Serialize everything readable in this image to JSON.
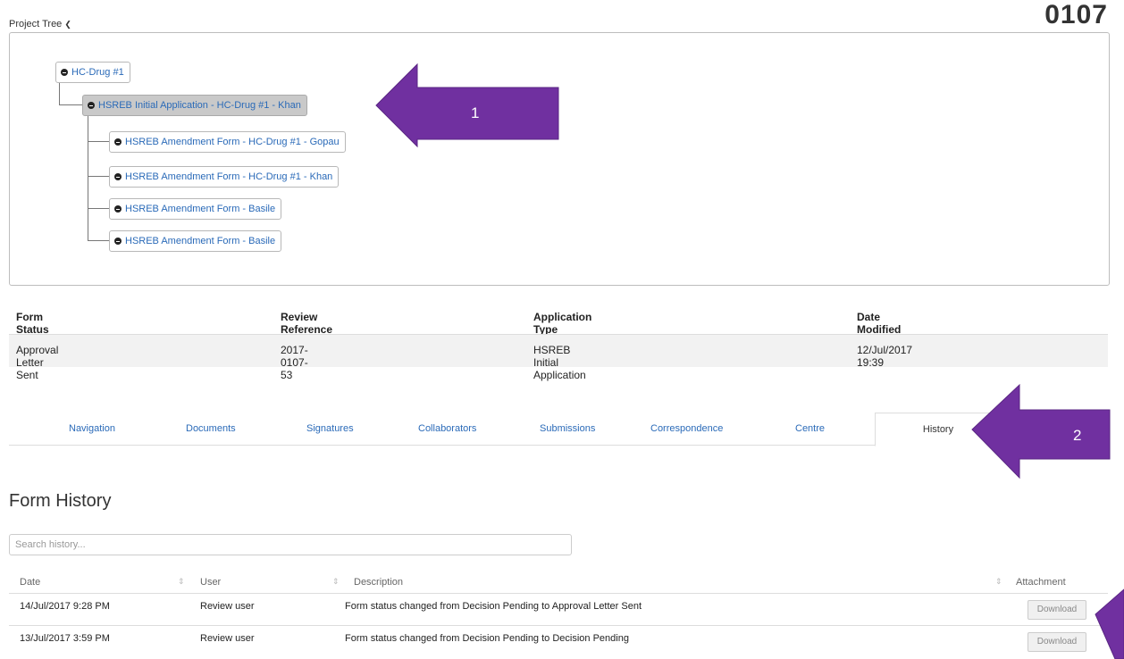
{
  "header": {
    "project_tree_label": "Project Tree",
    "page_number": "0107"
  },
  "tree": {
    "root": "HC-Drug #1",
    "selected": "HSREB Initial Application - HC-Drug #1 - Khan",
    "children": [
      "HSREB Amendment Form - HC-Drug #1 - Gopau",
      "HSREB Amendment Form - HC-Drug #1 - Khan",
      "HSREB Amendment Form - Basile",
      "HSREB Amendment Form - Basile"
    ]
  },
  "status": {
    "headers": [
      "Form Status",
      "Review Reference",
      "Application Type",
      "Date Modified"
    ],
    "values": [
      "Approval Letter Sent",
      "2017-0107-53",
      "HSREB Initial Application",
      "12/Jul/2017 19:39"
    ]
  },
  "tabs": [
    "Navigation",
    "Documents",
    "Signatures",
    "Collaborators",
    "Submissions",
    "Correspondence",
    "Centre",
    "History"
  ],
  "history": {
    "title": "Form History",
    "search_placeholder": "Search history...",
    "columns": [
      "Date",
      "User",
      "Description",
      "Attachment"
    ],
    "rows": [
      {
        "date": "14/Jul/2017 9:28 PM",
        "user": "Review user",
        "description": "Form status changed from Decision Pending to Approval Letter Sent",
        "attachment": "Download"
      },
      {
        "date": "13/Jul/2017 3:59 PM",
        "user": "Review user",
        "description": "Form status changed from Decision Pending to Decision Pending",
        "attachment": "Download"
      }
    ]
  },
  "annotations": {
    "arrow1": "1",
    "arrow2": "2",
    "arrow_color": "#7030a0"
  }
}
